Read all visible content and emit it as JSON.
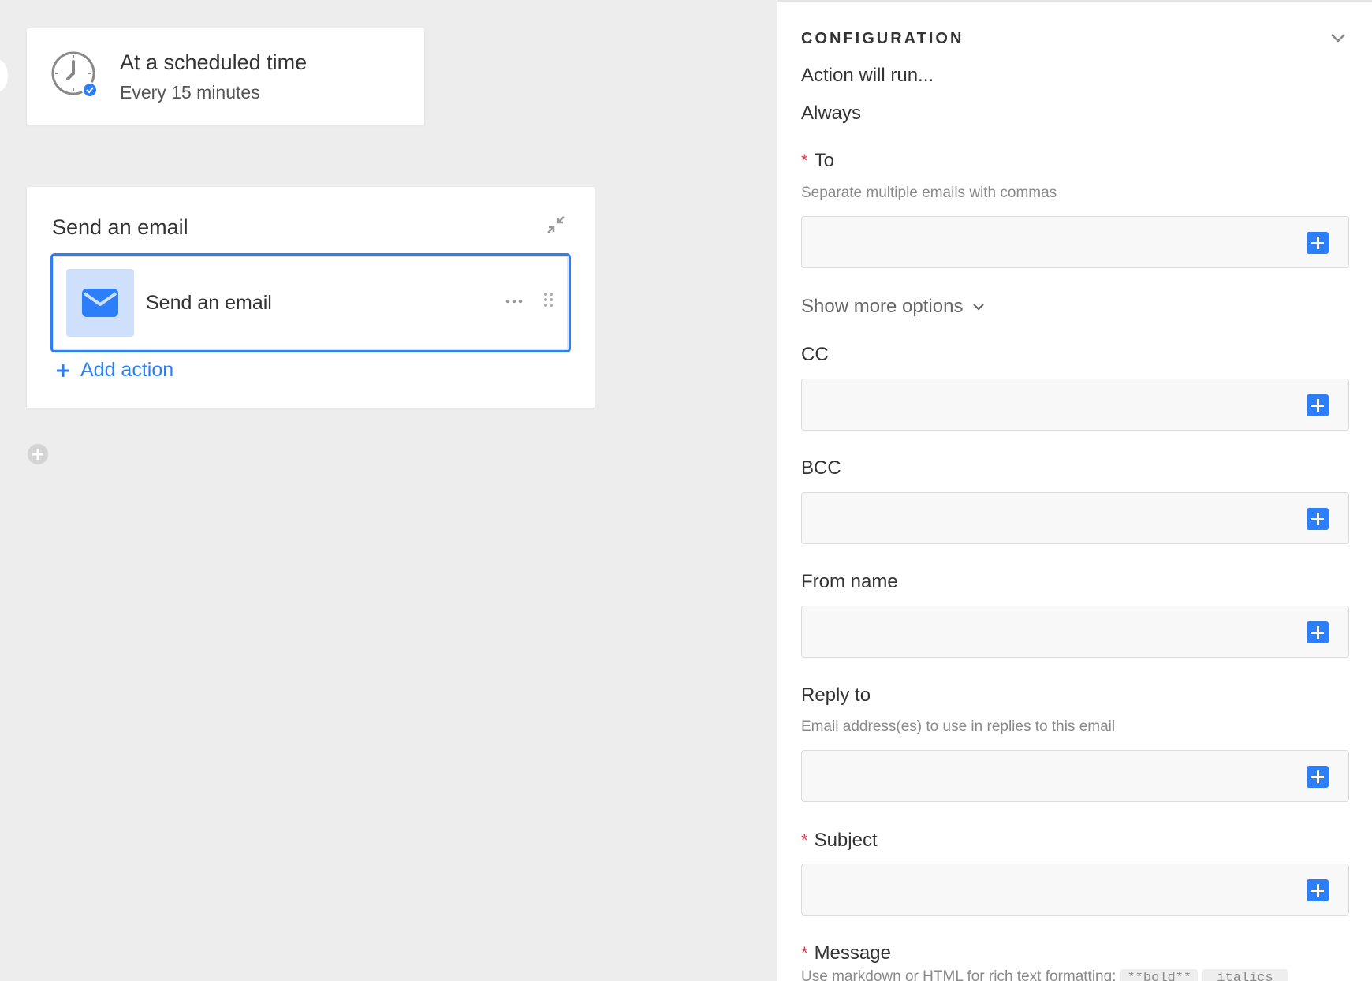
{
  "trigger": {
    "title": "At a scheduled time",
    "subtitle": "Every 15 minutes",
    "icon": "clock-icon"
  },
  "action_group": {
    "title": "Send an email",
    "action": {
      "label": "Send an email",
      "icon": "envelope-icon"
    },
    "add_action_label": "Add action"
  },
  "panel": {
    "header": "CONFIGURATION",
    "run_condition_label": "Action will run...",
    "run_condition_value": "Always",
    "show_more_label": "Show more options",
    "fields": {
      "to": {
        "label": "To",
        "required": true,
        "help": "Separate multiple emails with commas",
        "value": ""
      },
      "cc": {
        "label": "CC",
        "required": false,
        "value": ""
      },
      "bcc": {
        "label": "BCC",
        "required": false,
        "value": ""
      },
      "from_name": {
        "label": "From name",
        "required": false,
        "value": ""
      },
      "reply_to": {
        "label": "Reply to",
        "required": false,
        "help": "Email address(es) to use in replies to this email",
        "value": ""
      },
      "subject": {
        "label": "Subject",
        "required": true,
        "value": ""
      },
      "message": {
        "label": "Message",
        "required": true,
        "help": "Use markdown or HTML for rich text formatting:",
        "chip_bold": "**bold**",
        "chip_italic": "_italics_"
      }
    },
    "required_marker": "*"
  },
  "colors": {
    "accent": "#2d7ff9",
    "required": "#e8384f",
    "canvas_bg": "#ededed",
    "tile_bg": "#cfe0fd"
  }
}
